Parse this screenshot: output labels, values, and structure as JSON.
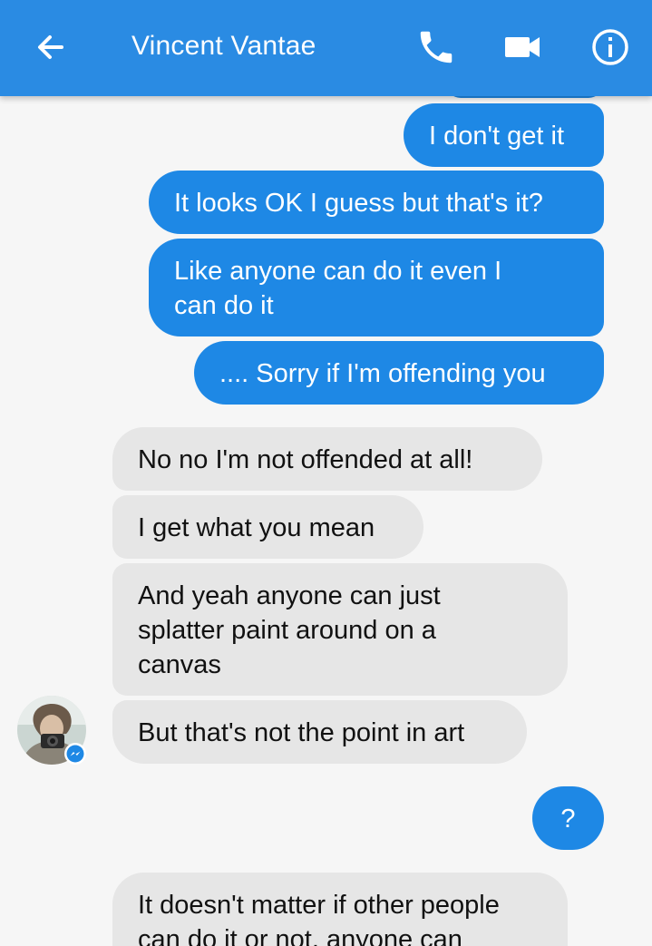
{
  "header": {
    "title": "Vincent Vantae",
    "back_icon": "arrow-left-icon",
    "call_icon": "phone-icon",
    "video_icon": "video-camera-icon",
    "info_icon": "info-icon",
    "color": "#2a8be3"
  },
  "messages": {
    "out_1": "I don't get it",
    "out_2": "It looks OK I guess but that's it?",
    "out_3": "Like anyone can do it even I\ncan do it",
    "out_4": ".... Sorry if I'm offending you",
    "in_1": "No no I'm not offended at all!",
    "in_2": "I get what you mean",
    "in_3": "And yeah anyone can just\nsplatter paint around on a\ncanvas",
    "in_4": "But that's not the point in art",
    "out_5": "?",
    "in_5": "It doesn't matter if other people\ncan do it or not, anyone can"
  },
  "colors": {
    "outgoing_bubble": "#1e88e5",
    "incoming_bubble": "#e6e6e6",
    "background": "#f6f6f6"
  }
}
